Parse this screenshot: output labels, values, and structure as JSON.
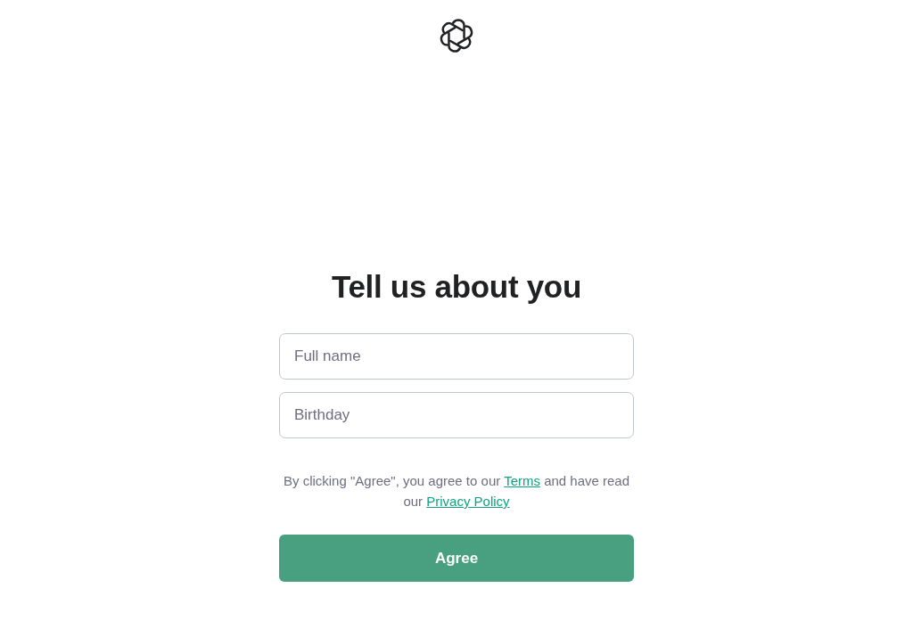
{
  "heading": "Tell us about you",
  "fields": [
    {
      "placeholder": "Full name"
    },
    {
      "placeholder": "Birthday"
    }
  ],
  "notice": {
    "before": "By clicking \"Agree\", you agree to our",
    "terms_link": "Terms",
    "middle": "and have read our",
    "privacy_link": "Privacy Policy"
  },
  "button": "Agree"
}
